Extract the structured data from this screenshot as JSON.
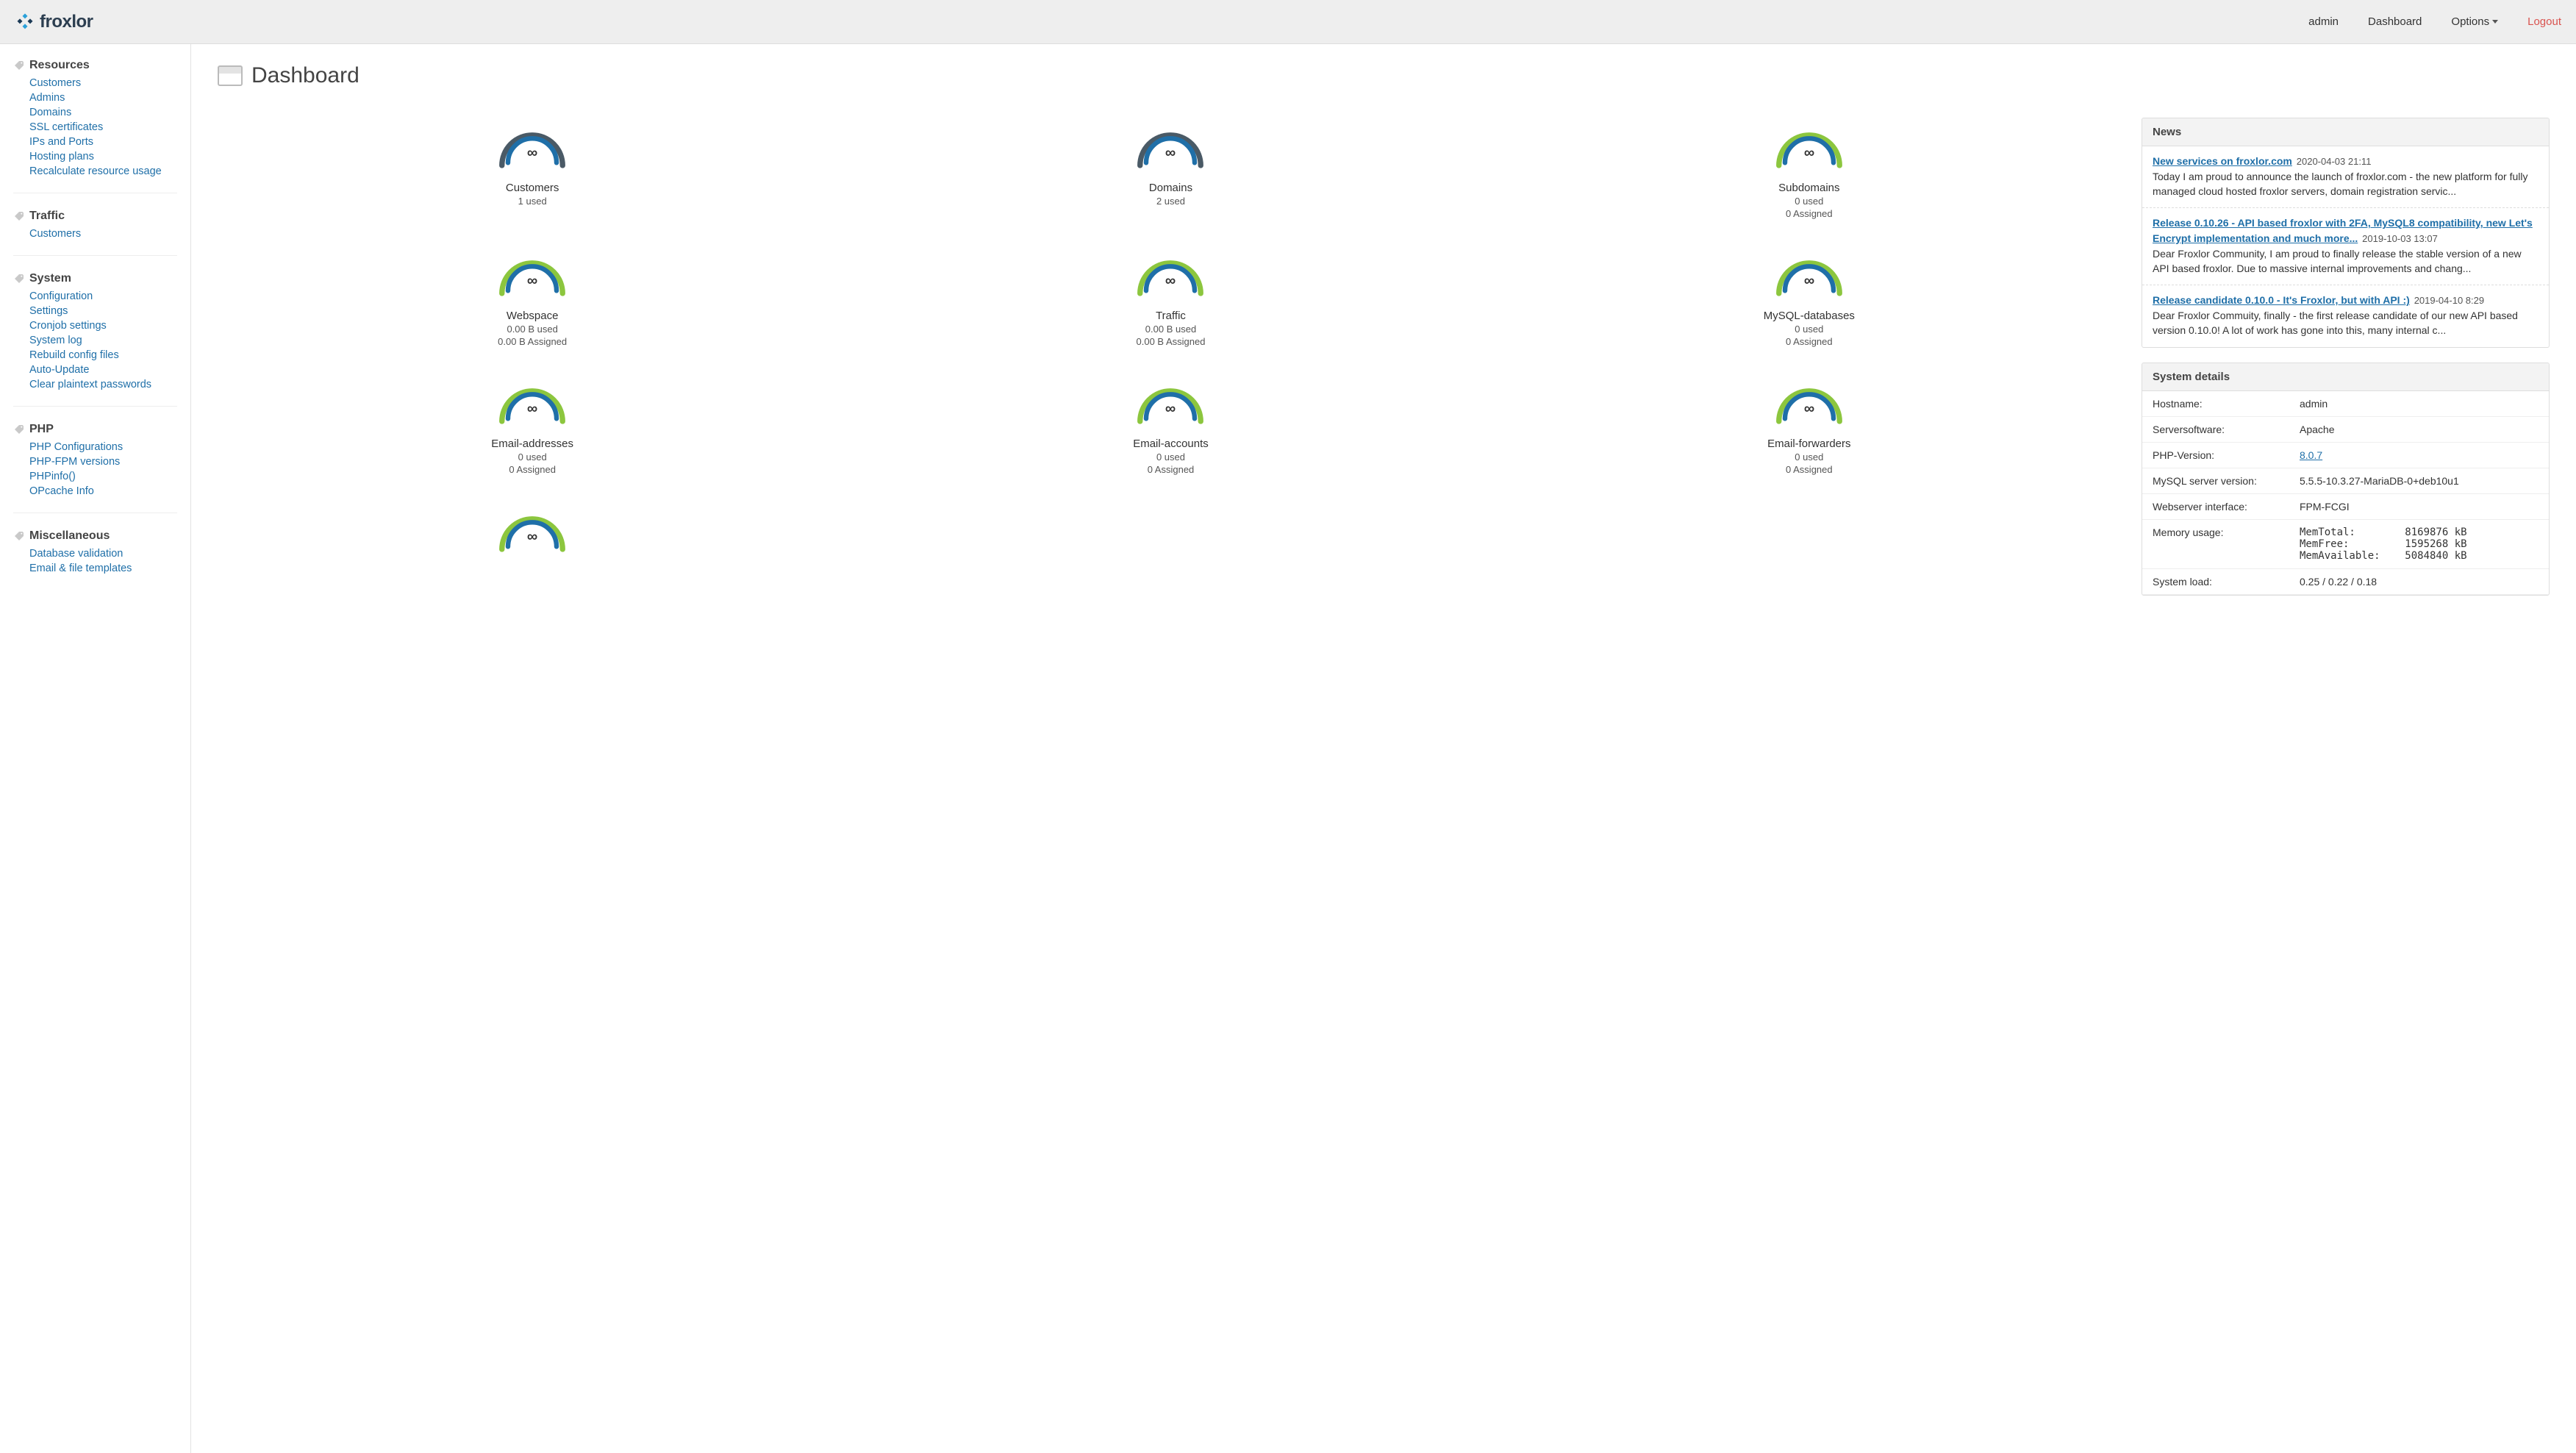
{
  "brand": "froxlor",
  "topnav": {
    "user": "admin",
    "dashboard": "Dashboard",
    "options": "Options",
    "logout": "Logout"
  },
  "sidebar": [
    {
      "title": "Resources",
      "items": [
        "Customers",
        "Admins",
        "Domains",
        "SSL certificates",
        "IPs and Ports",
        "Hosting plans",
        "Recalculate resource usage"
      ]
    },
    {
      "title": "Traffic",
      "items": [
        "Customers"
      ]
    },
    {
      "title": "System",
      "items": [
        "Configuration",
        "Settings",
        "Cronjob settings",
        "System log",
        "Rebuild config files",
        "Auto-Update",
        "Clear plaintext passwords"
      ]
    },
    {
      "title": "PHP",
      "items": [
        "PHP Configurations",
        "PHP-FPM versions",
        "PHPinfo()",
        "OPcache Info"
      ]
    },
    {
      "title": "Miscellaneous",
      "items": [
        "Database validation",
        "Email & file templates"
      ]
    }
  ],
  "page_title": "Dashboard",
  "gauges": [
    {
      "symbol": "∞",
      "label": "Customers",
      "sub": [
        "1 used"
      ],
      "style": "gray"
    },
    {
      "symbol": "∞",
      "label": "Domains",
      "sub": [
        "2 used"
      ],
      "style": "gray"
    },
    {
      "symbol": "∞",
      "label": "Subdomains",
      "sub": [
        "0 used",
        "0 Assigned"
      ],
      "style": "green"
    },
    {
      "symbol": "∞",
      "label": "Webspace",
      "sub": [
        "0.00 B used",
        "0.00 B Assigned"
      ],
      "style": "green"
    },
    {
      "symbol": "∞",
      "label": "Traffic",
      "sub": [
        "0.00 B used",
        "0.00 B Assigned"
      ],
      "style": "green"
    },
    {
      "symbol": "∞",
      "label": "MySQL-databases",
      "sub": [
        "0 used",
        "0 Assigned"
      ],
      "style": "green"
    },
    {
      "symbol": "∞",
      "label": "Email-addresses",
      "sub": [
        "0 used",
        "0 Assigned"
      ],
      "style": "green"
    },
    {
      "symbol": "∞",
      "label": "Email-accounts",
      "sub": [
        "0 used",
        "0 Assigned"
      ],
      "style": "green"
    },
    {
      "symbol": "∞",
      "label": "Email-forwarders",
      "sub": [
        "0 used",
        "0 Assigned"
      ],
      "style": "green"
    },
    {
      "symbol": "∞",
      "label": "",
      "sub": [],
      "style": "green"
    }
  ],
  "news_heading": "News",
  "news": [
    {
      "title": "New services on froxlor.com",
      "date": "2020-04-03 21:11",
      "body": "Today I am proud to announce the launch of froxlor.com - the new platform for fully managed cloud hosted froxlor servers, domain registration servic..."
    },
    {
      "title": "Release 0.10.26 - API based froxlor with 2FA, MySQL8 compatibility, new Let's Encrypt implementation and much more...",
      "date": "2019-10-03 13:07",
      "body": "Dear Froxlor Community, I am proud to finally release the stable version of a new API based froxlor. Due to massive internal improvements and chang..."
    },
    {
      "title": "Release candidate 0.10.0 - It's Froxlor, but with API :)",
      "date": "2019-04-10 8:29",
      "body": "Dear Froxlor Commuity, finally - the first release candidate of our new API based version 0.10.0! A lot of work has gone into this, many internal c..."
    }
  ],
  "system_heading": "System details",
  "system": [
    {
      "label": "Hostname:",
      "value": "admin",
      "link": false
    },
    {
      "label": "Serversoftware:",
      "value": "Apache",
      "link": false
    },
    {
      "label": "PHP-Version:",
      "value": "8.0.7",
      "link": true
    },
    {
      "label": "MySQL server version:",
      "value": "5.5.5-10.3.27-MariaDB-0+deb10u1",
      "link": false
    },
    {
      "label": "Webserver interface:",
      "value": "FPM-FCGI",
      "link": false
    },
    {
      "label": "Memory usage:",
      "value": "MemTotal:        8169876 kB\nMemFree:         1595268 kB\nMemAvailable:    5084840 kB",
      "mono": true
    },
    {
      "label": "System load:",
      "value": "0.25 / 0.22 / 0.18",
      "link": false
    }
  ]
}
